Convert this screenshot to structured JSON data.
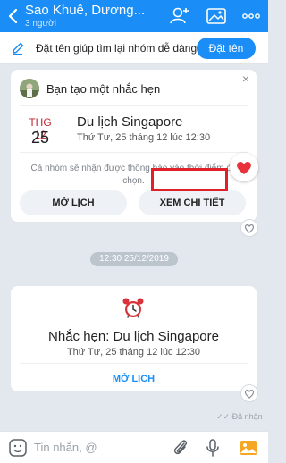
{
  "header": {
    "title": "Sao Khuê, Dương...",
    "subtitle": "3 người"
  },
  "banner": {
    "text": "Đặt tên giúp tìm lại nhóm dễ dàng",
    "button": "Đặt tên"
  },
  "reminder_card": {
    "close": "×",
    "heading": "Bạn tạo một nhắc hẹn",
    "month": "THG 12",
    "day": "25",
    "event_title": "Du lịch Singapore",
    "event_time": "Thứ Tư, 25 tháng 12 lúc 12:30",
    "notice": "Cả nhóm sẽ nhận được thông báo vào thời điểm đã chọn.",
    "open_calendar": "MỞ LỊCH",
    "view_detail": "XEM CHI TIẾT"
  },
  "timestamp": "12:30 25/12/2019",
  "reminder_message": {
    "title": "Nhắc hẹn: Du lịch Singapore",
    "time": "Thứ Tư, 25 tháng 12 lúc 12:30",
    "open_calendar": "MỞ LỊCH"
  },
  "status": {
    "seen": "✓✓ Đã nhận"
  },
  "composer": {
    "placeholder": "Tin nhắn, @"
  },
  "colors": {
    "header": "#1a8ef6",
    "accent": "#1a8ef6",
    "month": "#c0252f",
    "highlight": "#e0202a",
    "heart": "#e8323c"
  }
}
